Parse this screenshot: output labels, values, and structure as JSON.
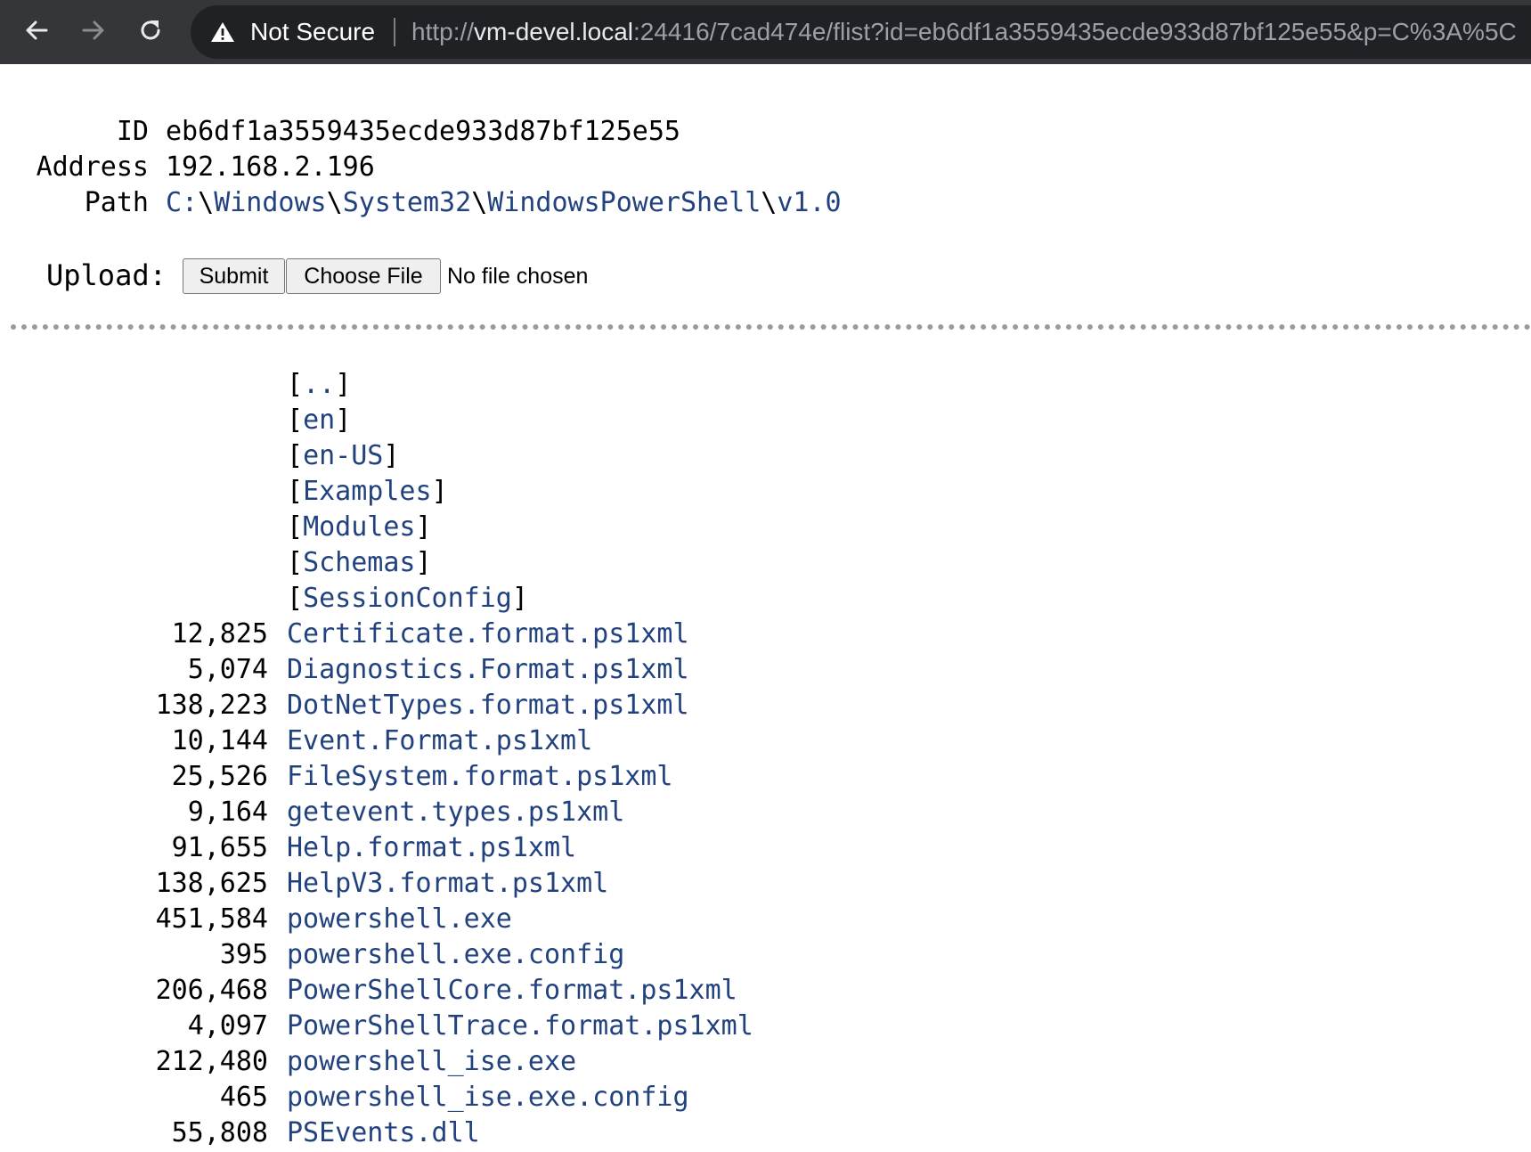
{
  "browser": {
    "security_label": "Not Secure",
    "url_scheme": "http://",
    "url_host": "vm-devel.local",
    "url_rest": ":24416/7cad474e/flist?id=eb6df1a3559435ecde933d87bf125e55&p=C%3A%5C"
  },
  "info": {
    "id_label": "ID",
    "id_value": "eb6df1a3559435ecde933d87bf125e55",
    "address_label": "Address",
    "address_value": "192.168.2.196",
    "path_label": "Path",
    "path_parts": [
      "C:",
      "Windows",
      "System32",
      "WindowsPowerShell",
      "v1.0"
    ],
    "path_separator": "\\"
  },
  "upload": {
    "label": "Upload:",
    "submit_label": "Submit",
    "choose_label": "Choose File",
    "status": "No file chosen"
  },
  "directories": [
    "..",
    "en",
    "en-US",
    "Examples",
    "Modules",
    "Schemas",
    "SessionConfig"
  ],
  "files": [
    {
      "size": "12,825",
      "name": "Certificate.format.ps1xml"
    },
    {
      "size": "5,074",
      "name": "Diagnostics.Format.ps1xml"
    },
    {
      "size": "138,223",
      "name": "DotNetTypes.format.ps1xml"
    },
    {
      "size": "10,144",
      "name": "Event.Format.ps1xml"
    },
    {
      "size": "25,526",
      "name": "FileSystem.format.ps1xml"
    },
    {
      "size": "9,164",
      "name": "getevent.types.ps1xml"
    },
    {
      "size": "91,655",
      "name": "Help.format.ps1xml"
    },
    {
      "size": "138,625",
      "name": "HelpV3.format.ps1xml"
    },
    {
      "size": "451,584",
      "name": "powershell.exe"
    },
    {
      "size": "395",
      "name": "powershell.exe.config"
    },
    {
      "size": "206,468",
      "name": "PowerShellCore.format.ps1xml"
    },
    {
      "size": "4,097",
      "name": "PowerShellTrace.format.ps1xml"
    },
    {
      "size": "212,480",
      "name": "powershell_ise.exe"
    },
    {
      "size": "465",
      "name": "powershell_ise.exe.config"
    },
    {
      "size": "55,808",
      "name": "PSEvents.dll"
    }
  ],
  "colors": {
    "toolbar_bg": "#35363a",
    "omnibox_bg": "#202124",
    "link": "#22427f"
  },
  "icons": [
    "back-arrow-icon",
    "forward-arrow-icon",
    "reload-icon",
    "warning-icon"
  ]
}
